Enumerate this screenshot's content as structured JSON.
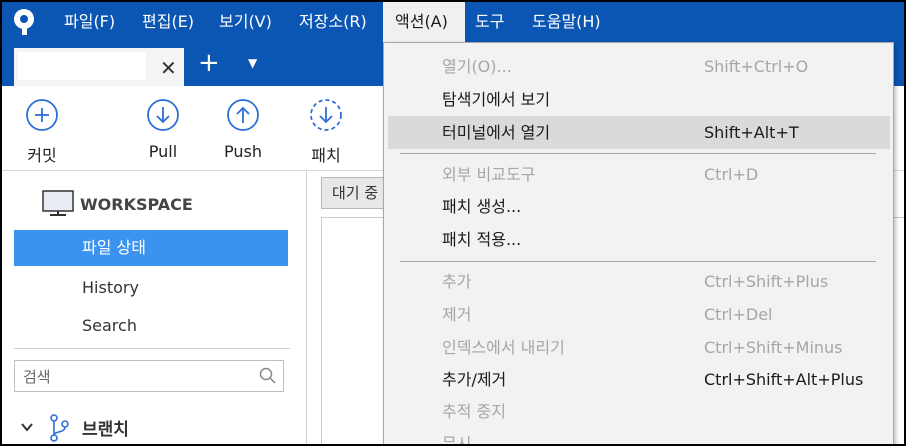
{
  "menubar": {
    "items": [
      {
        "label": "파일(F)"
      },
      {
        "label": "편집(E)"
      },
      {
        "label": "보기(V)"
      },
      {
        "label": "저장소(R)"
      },
      {
        "label": "액션(A)"
      },
      {
        "label": "도구"
      },
      {
        "label": "도움말(H)"
      }
    ],
    "active_index": 4
  },
  "tabs": {
    "add_icon": "plus-icon",
    "dropdown_icon": "caret-down-icon",
    "close_icon": "close-icon"
  },
  "toolbar": {
    "buttons": [
      {
        "label": "커밋",
        "icon": "plus-circle-icon"
      },
      {
        "label": "Pull",
        "icon": "arrow-down-circle-icon"
      },
      {
        "label": "Push",
        "icon": "arrow-up-circle-icon"
      },
      {
        "label": "패치",
        "icon": "dashed-arrow-down-circle-icon"
      }
    ]
  },
  "sidebar": {
    "workspace": {
      "label": "WORKSPACE",
      "icon": "monitor-icon"
    },
    "items": [
      {
        "label": "파일 상태",
        "selected": true
      },
      {
        "label": "History",
        "selected": false
      },
      {
        "label": "Search",
        "selected": false
      }
    ],
    "search": {
      "placeholder": "검색",
      "value": ""
    },
    "branches": {
      "label": "브랜치",
      "icon": "branch-icon",
      "expanded": true
    }
  },
  "main": {
    "pending_tab": "대기 중"
  },
  "dropdown": {
    "items": [
      {
        "label": "열기(O)...",
        "shortcut": "Shift+Ctrl+O",
        "disabled": true
      },
      {
        "label": "탐색기에서 보기",
        "shortcut": "",
        "disabled": false
      },
      {
        "label": "터미널에서 열기",
        "shortcut": "Shift+Alt+T",
        "disabled": false,
        "hover": true
      },
      {
        "separator": true
      },
      {
        "label": "외부 비교도구",
        "shortcut": "Ctrl+D",
        "disabled": true
      },
      {
        "label": "패치 생성...",
        "shortcut": "",
        "disabled": false
      },
      {
        "label": "패치 적용...",
        "shortcut": "",
        "disabled": false
      },
      {
        "separator": true
      },
      {
        "label": "추가",
        "shortcut": "Ctrl+Shift+Plus",
        "disabled": true
      },
      {
        "label": "제거",
        "shortcut": "Ctrl+Del",
        "disabled": true
      },
      {
        "label": "인덱스에서 내리기",
        "shortcut": "Ctrl+Shift+Minus",
        "disabled": true
      },
      {
        "label": "추가/제거",
        "shortcut": "Ctrl+Shift+Alt+Plus",
        "disabled": false
      },
      {
        "label": "추적 중지",
        "shortcut": "",
        "disabled": true
      },
      {
        "label": "무시",
        "shortcut": "",
        "disabled": true
      }
    ]
  },
  "colors": {
    "menubar_bg": "#0b56b3",
    "accent_icon": "#2d6fd8",
    "selected_nav": "#3c93ef",
    "menu_bg": "#f2f2f2",
    "menu_hover": "#dadada",
    "disabled_text": "#a6a6a6"
  }
}
